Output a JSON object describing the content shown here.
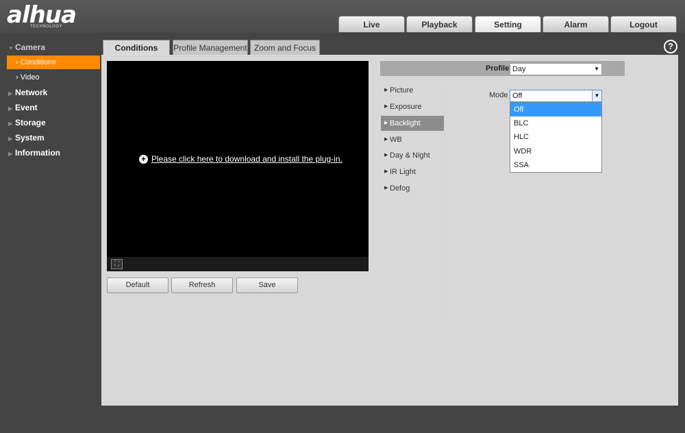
{
  "brand": {
    "name": "alhua",
    "subtitle": "TECHNOLOGY"
  },
  "top_nav": [
    "Live",
    "Playback",
    "Setting",
    "Alarm",
    "Logout"
  ],
  "top_nav_active": "Setting",
  "sidebar": {
    "camera": "Camera",
    "conditions": "Conditions",
    "video": "Video",
    "network": "Network",
    "event": "Event",
    "storage": "Storage",
    "system": "System",
    "information": "Information"
  },
  "sub_tabs": [
    "Conditions",
    "Profile Management",
    "Zoom and Focus"
  ],
  "help": "?",
  "video": {
    "plugin_link": "Please click here to download and install the plug-in."
  },
  "buttons": {
    "default": "Default",
    "refresh": "Refresh",
    "save": "Save"
  },
  "profile": {
    "label": "Profile",
    "value": "Day"
  },
  "menu": [
    "Picture",
    "Exposure",
    "Backlight",
    "WB",
    "Day & Night",
    "IR Light",
    "Defog"
  ],
  "menu_active": "Backlight",
  "mode": {
    "label": "Mode",
    "value": "Off",
    "options": [
      "Off",
      "BLC",
      "HLC",
      "WDR",
      "SSA"
    ]
  },
  "colors": {
    "accent": "#ff8a00",
    "selection": "#3399ff"
  }
}
